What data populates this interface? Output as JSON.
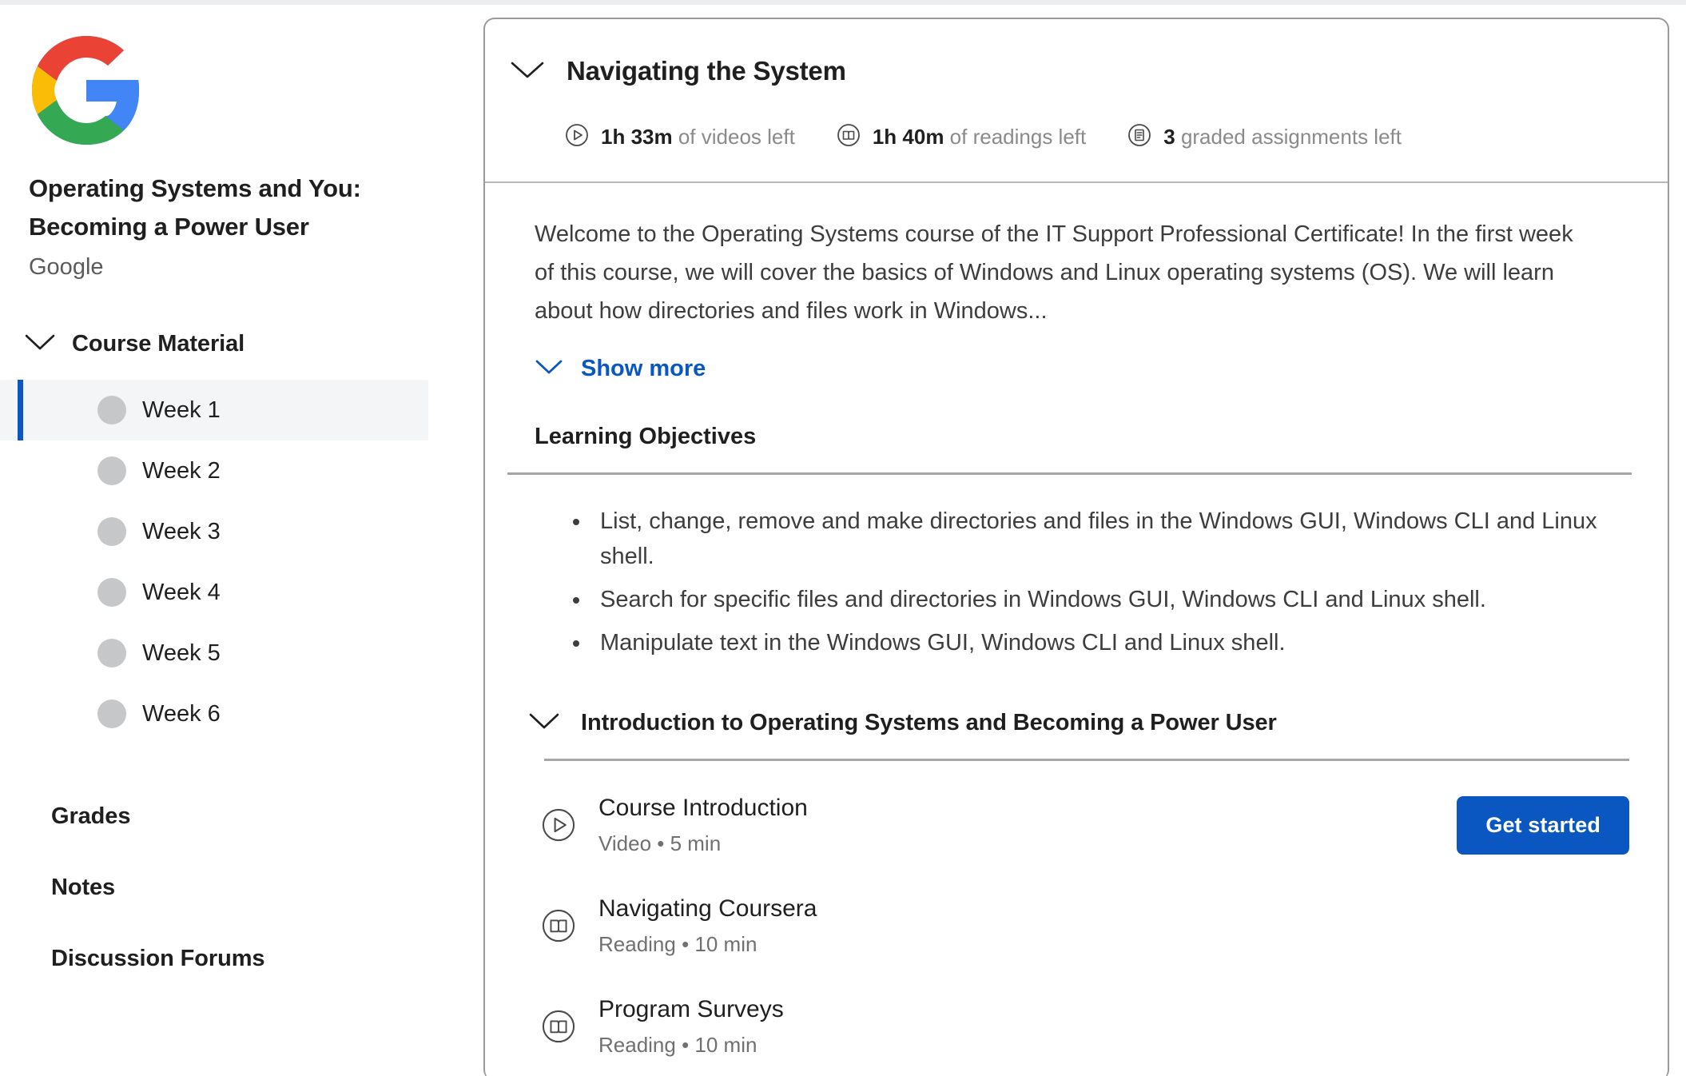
{
  "sidebar": {
    "logo_icon": "google-logo",
    "course_title_line1": "Operating Systems and You:",
    "course_title_line2": "Becoming a Power User",
    "provider": "Google",
    "course_material": {
      "label": "Course Material",
      "chevron_icon": "chevron-down-icon"
    },
    "weeks": [
      {
        "label": "Week 1",
        "active": true
      },
      {
        "label": "Week 2",
        "active": false
      },
      {
        "label": "Week 3",
        "active": false
      },
      {
        "label": "Week 4",
        "active": false
      },
      {
        "label": "Week 5",
        "active": false
      },
      {
        "label": "Week 6",
        "active": false
      }
    ],
    "links": [
      {
        "label": "Grades"
      },
      {
        "label": "Notes"
      },
      {
        "label": "Discussion Forums"
      }
    ]
  },
  "main": {
    "header": {
      "chevron_icon": "chevron-down-icon",
      "title": "Navigating the System",
      "stats": [
        {
          "icon": "play-circle-icon",
          "value": "1h 33m",
          "label": "of videos left"
        },
        {
          "icon": "book-circle-icon",
          "value": "1h 40m",
          "label": "of readings left"
        },
        {
          "icon": "assignment-circle-icon",
          "value": "3",
          "label": "graded assignments left"
        }
      ]
    },
    "description": "Welcome to the Operating Systems course of the IT Support Professional Certificate! In the first week of this course, we will cover the basics of Windows and Linux operating systems (OS). We will learn about how directories and files work in Windows...",
    "show_more": {
      "label": "Show more",
      "chevron_icon": "chevron-down-icon"
    },
    "objectives": {
      "title": "Learning Objectives",
      "items": [
        "List, change, remove and make directories and files in the Windows GUI, Windows CLI and Linux shell.",
        "Search for specific files and directories in Windows GUI, Windows CLI and Linux shell.",
        "Manipulate text in the Windows GUI, Windows CLI and Linux shell."
      ]
    },
    "section": {
      "chevron_icon": "chevron-down-icon",
      "title": "Introduction to Operating Systems and Becoming a Power User",
      "lessons": [
        {
          "icon": "play-circle-icon",
          "name": "Course Introduction",
          "meta": "Video • 5 min",
          "button": "Get started"
        },
        {
          "icon": "book-circle-icon",
          "name": "Navigating Coursera",
          "meta": "Reading • 10 min"
        },
        {
          "icon": "book-circle-icon",
          "name": "Program Surveys",
          "meta": "Reading • 10 min"
        }
      ]
    }
  },
  "colors": {
    "accent_blue": "#0b57c2",
    "active_bg": "#f4f5f6",
    "google_red": "#ea4335",
    "google_yellow": "#fbbc05",
    "google_green": "#34a853",
    "google_blue": "#4285f4"
  }
}
